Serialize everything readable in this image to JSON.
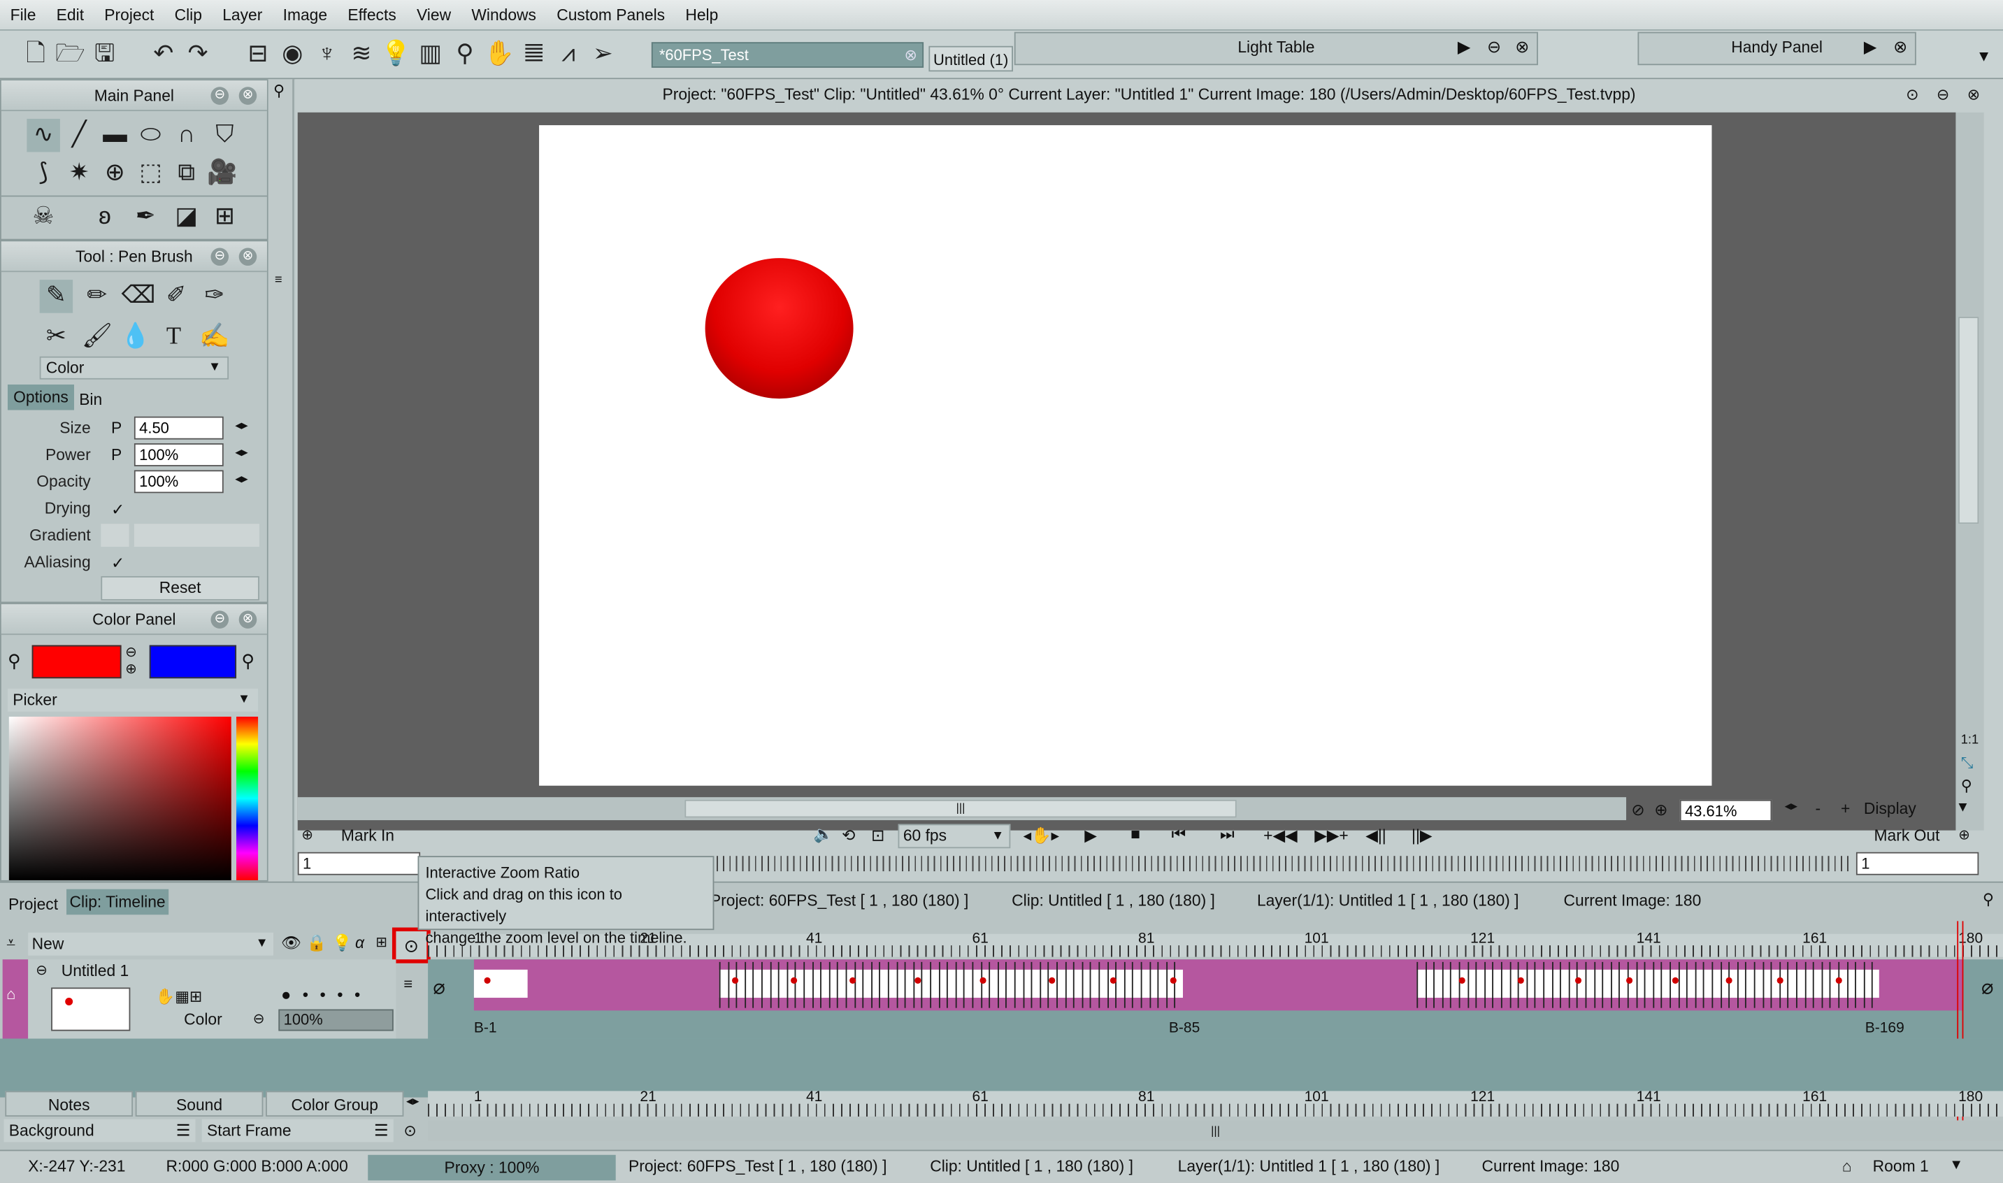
{
  "menu": [
    "File",
    "Edit",
    "Project",
    "Clip",
    "Layer",
    "Image",
    "Effects",
    "View",
    "Windows",
    "Custom Panels",
    "Help"
  ],
  "toolbar": {
    "project_tab": "*60FPS_Test",
    "clip_tab": "Untitled (1)",
    "light_table": "Light Table",
    "handy_panel": "Handy Panel"
  },
  "main_panel": {
    "title": "Main Panel"
  },
  "tool_panel": {
    "title": "Tool : Pen Brush",
    "color_select": "Color",
    "tab_options": "Options",
    "tab_bin": "Bin",
    "size_label": "Size",
    "size_value": "4.50",
    "power_label": "Power",
    "power_value": "100%",
    "opacity_label": "Opacity",
    "opacity_value": "100%",
    "drying_label": "Drying",
    "gradient_label": "Gradient",
    "aaliasing_label": "AAliasing",
    "reset": "Reset",
    "p": "P",
    "check": "✓"
  },
  "color_panel": {
    "title": "Color Panel",
    "primary": "#ff0000",
    "secondary": "#0000ff",
    "picker": "Picker"
  },
  "viewer": {
    "title": "Project:  \"60FPS_Test\"  Clip: \"Untitled\"   43.61%   0°  Current Layer: \"Untitled 1\"  Current Image: 180 (/Users/Admin/Desktop/60FPS_Test.tvpp)",
    "zoom": "43.61%",
    "display": "Display",
    "fps": "60 fps",
    "mark_in": "Mark In",
    "mark_out": "Mark Out",
    "mark_in_value": "1",
    "mark_out_value": "1"
  },
  "tooltip": {
    "title": "Interactive Zoom Ratio",
    "line1": "Click and drag on this icon to interactively",
    "line2": "change the zoom level on the timeline."
  },
  "timeline": {
    "tab_project": "Project",
    "tab_clip": "Clip: Timeline",
    "info_project": "Project: 60FPS_Test [ 1 , 180  (180) ]",
    "info_clip": "Clip: Untitled [ 1 , 180  (180) ]",
    "info_layer": "Layer(1/1): Untitled 1 [ 1 , 180  (180) ]",
    "info_image": "Current Image: 180",
    "new": "New",
    "layer_name": "Untitled 1",
    "layer_mode": "Color",
    "layer_opacity": "100%",
    "ticks": [
      "1",
      "21",
      "41",
      "61",
      "81",
      "101",
      "121",
      "141",
      "161",
      "180"
    ],
    "block_labels": [
      "B-1",
      "B-85",
      "B-169"
    ],
    "notes": "Notes",
    "sound": "Sound",
    "color_group": "Color Group",
    "background": "Background",
    "start_frame": "Start Frame"
  },
  "status": {
    "coords": "X:-247  Y:-231",
    "rgba": "R:000 G:000 B:000 A:000",
    "proxy": "Proxy : 100%",
    "project": "Project: 60FPS_Test [ 1 , 180  (180) ]",
    "clip": "Clip: Untitled [ 1 , 180  (180) ]",
    "layer": "Layer(1/1): Untitled 1 [ 1 , 180  (180) ]",
    "image": "Current Image: 180",
    "room": "Room 1"
  }
}
